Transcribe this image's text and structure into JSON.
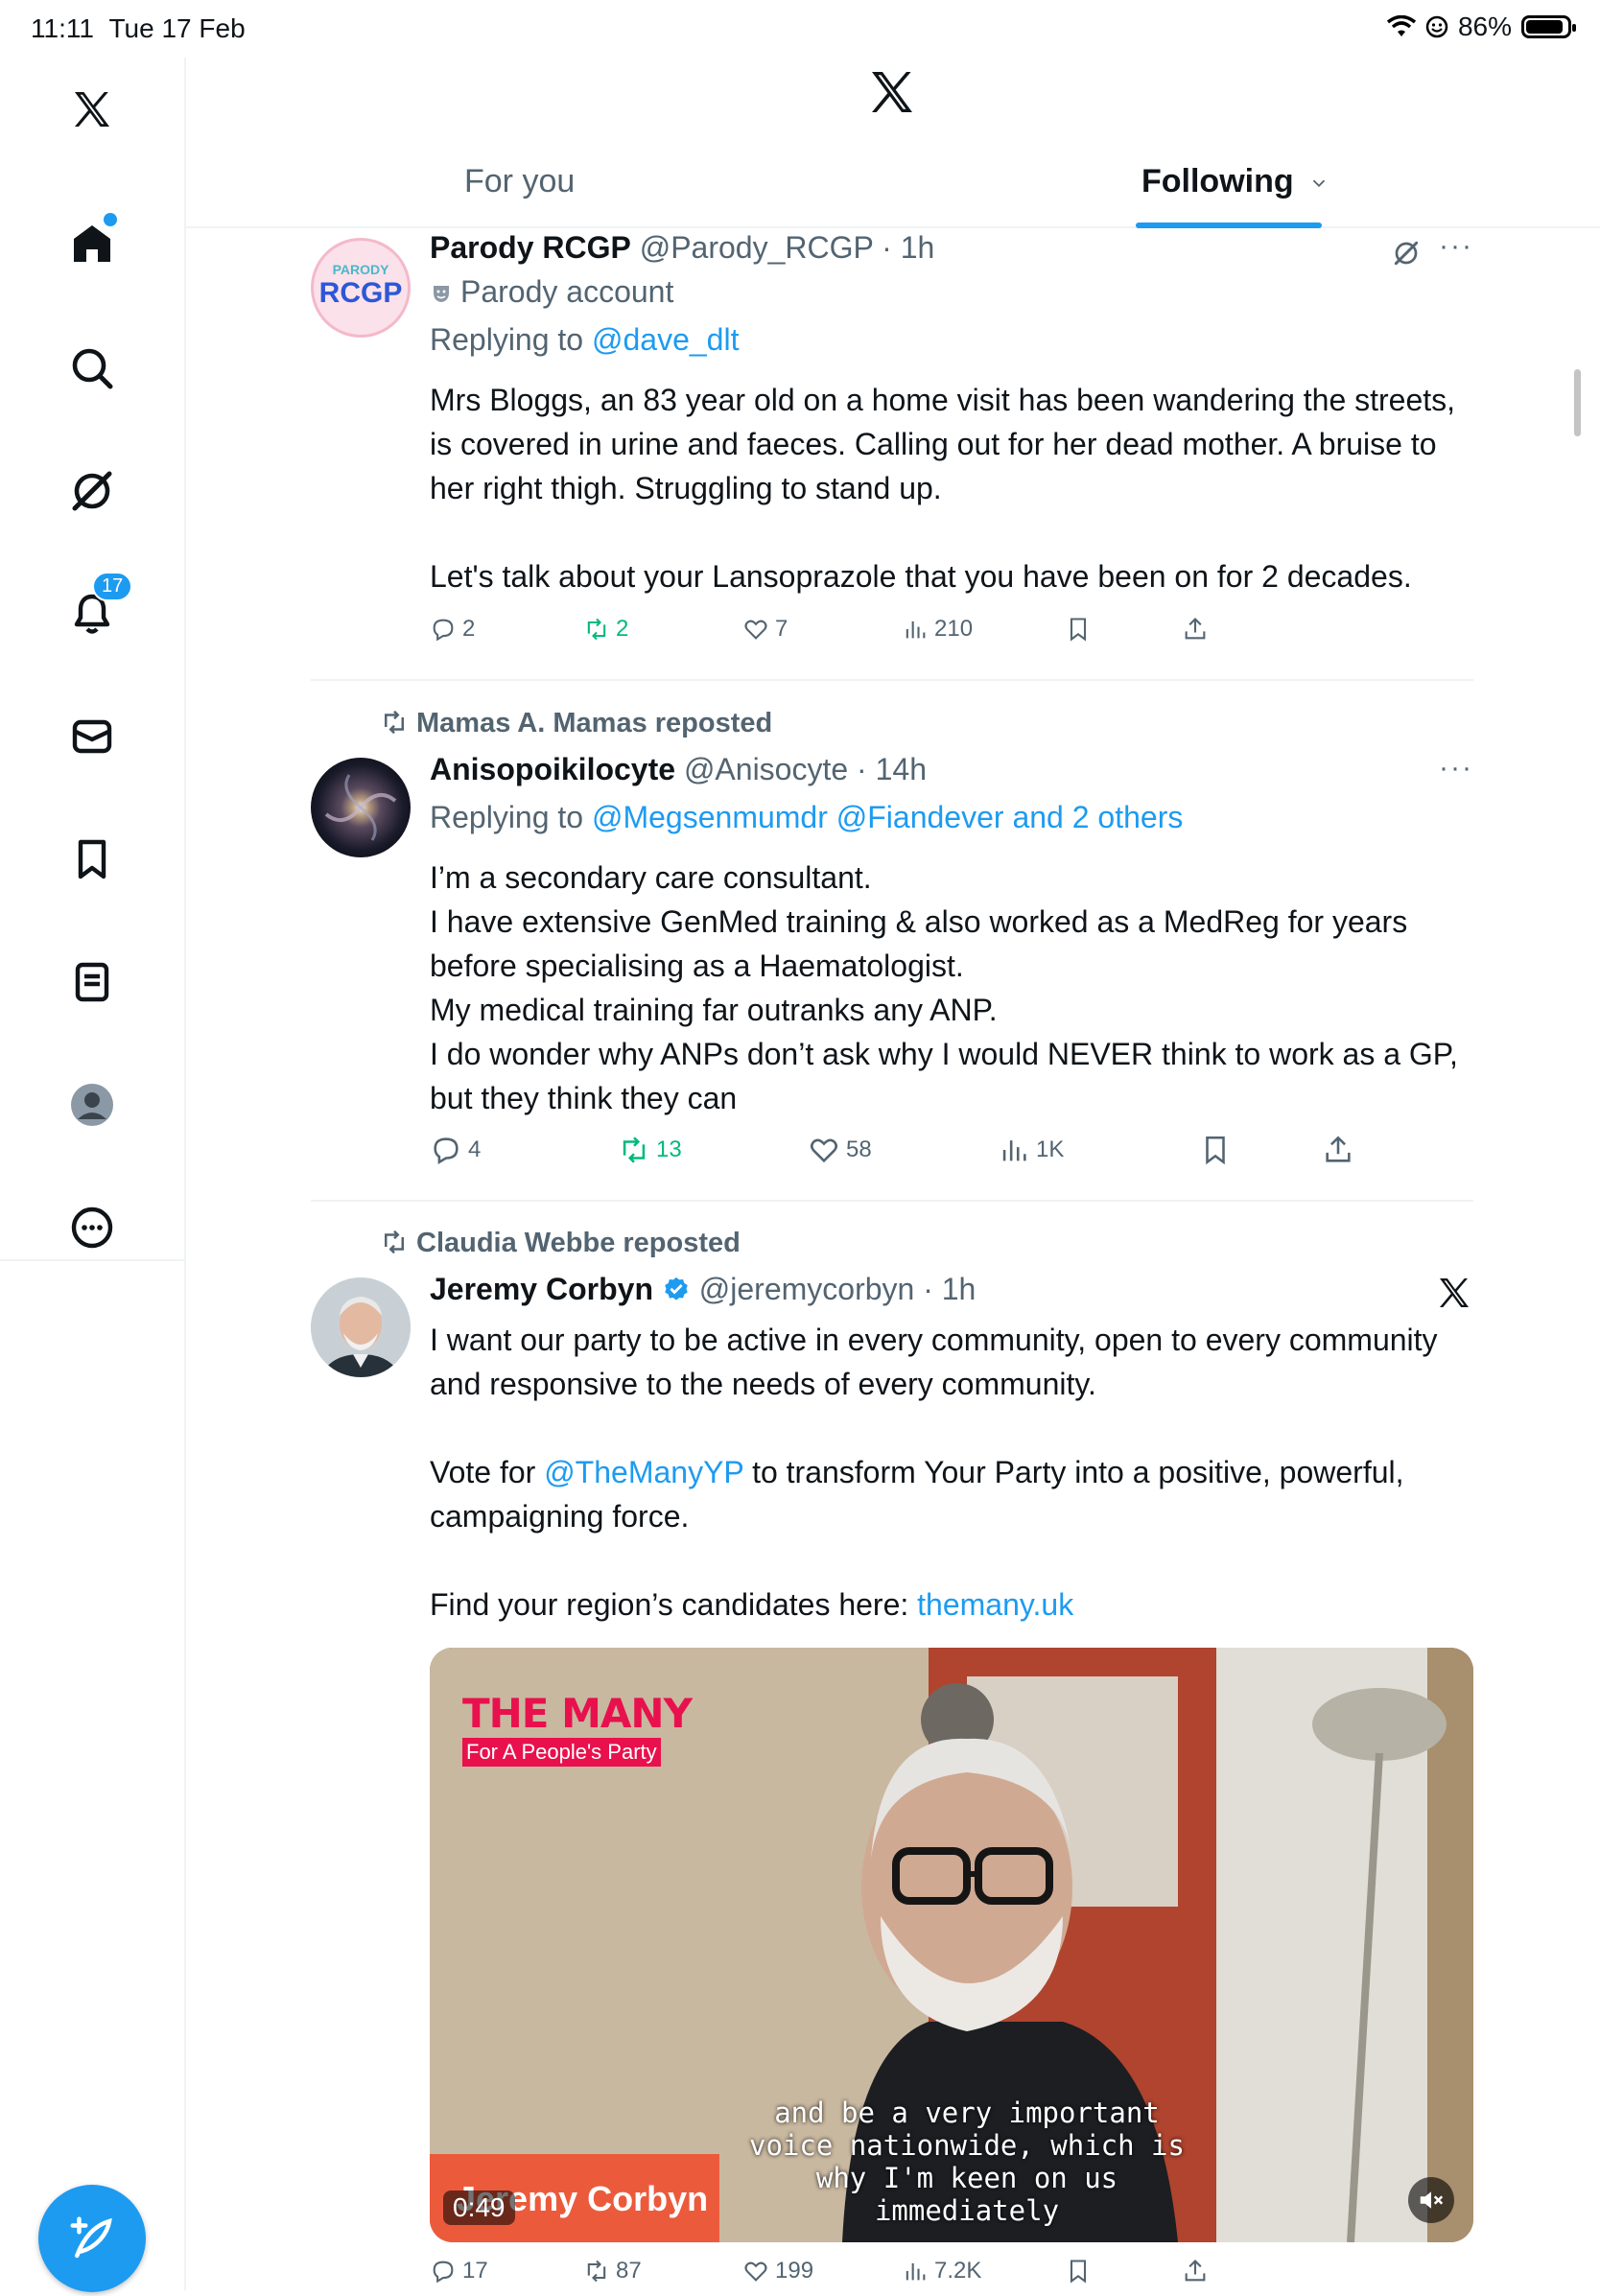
{
  "status_bar": {
    "time": "11:11",
    "date": "Tue 17 Feb",
    "battery": "86%"
  },
  "sidebar": {
    "notifications_badge": "17"
  },
  "tabs": {
    "for_you": "For you",
    "following": "Following"
  },
  "tweets": [
    {
      "name": "Parody RCGP",
      "handle": "@Parody_RCGP",
      "time": "1h",
      "avatar_text_top": "PARODY",
      "avatar_text": "RCGP",
      "parody_label": "Parody account",
      "replying_prefix": "Replying to ",
      "replying_to": "@dave_dlt",
      "body": [
        "Mrs Bloggs, an 83 year old on a home visit has been wandering the streets, is covered in urine and faeces. Calling out for her dead mother. A bruise to her right thigh. Struggling to stand up.",
        "Let's talk about your Lansoprazole that you have been on for 2 decades."
      ],
      "replies": "2",
      "reposts": "2",
      "likes": "7",
      "views": "210"
    },
    {
      "reposted_by": "Mamas A. Mamas reposted",
      "name": "Anisopoikilocyte",
      "handle": "@Anisocyte",
      "time": "14h",
      "replying_prefix": "Replying to ",
      "replying_to": "@Megsenmumdr @Fiandever and 2 others",
      "body": [
        "I’m a secondary care consultant.",
        "I have extensive GenMed training & also worked as a MedReg for years before specialising as a Haematologist.",
        "My medical training far outranks any ANP.",
        "I do wonder why ANPs don’t ask why I would NEVER think to work as a GP, but they think they can"
      ],
      "replies": "4",
      "reposts": "13",
      "likes": "58",
      "views": "1K"
    },
    {
      "reposted_by": "Claudia Webbe reposted",
      "name": "Jeremy Corbyn",
      "handle": "@jeremycorbyn",
      "time": "1h",
      "body_1": "I want our party to be active in every community, open to every community and responsive to the needs of every community.",
      "body_2_prefix": "Vote for ",
      "body_2_link": "@TheManyYP",
      "body_2_suffix": " to transform Your Party into a positive, powerful, campaigning force.",
      "body_3_prefix": "Find your region’s candidates here: ",
      "body_3_link": "themany.uk",
      "video": {
        "logo": "THE MANY",
        "logo_sub": "For A People's Party",
        "name_tag": "Jeremy Corbyn",
        "duration": "0:49",
        "subtitle_1": "and be a very important",
        "subtitle_2": "voice nationwide, which is",
        "subtitle_3": "why I'm keen on us",
        "subtitle_4": "immediately"
      },
      "replies": "17",
      "reposts": "87",
      "likes": "199",
      "views": "7.2K"
    }
  ],
  "colors": {
    "accent": "#1d9bf0",
    "repost_green": "#00ba7c",
    "secondary_text": "#536471",
    "parody_red": "#e8114d"
  }
}
